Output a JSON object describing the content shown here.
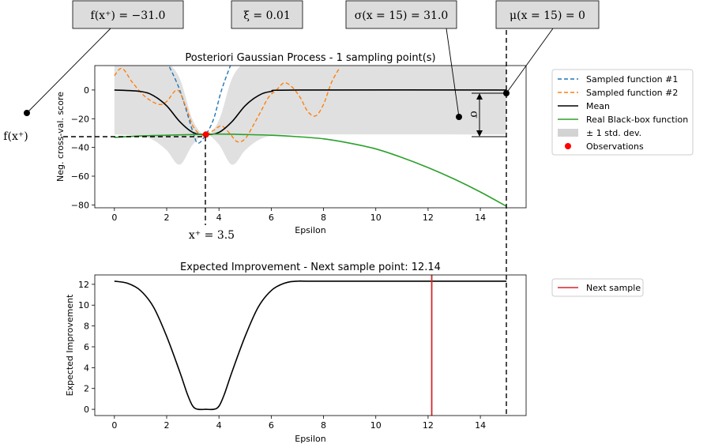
{
  "chart_data": [
    {
      "type": "line",
      "title": "Posteriori Gaussian Process - 1 sampling point(s)",
      "xlabel": "Epsilon",
      "ylabel": "Neg. cross-val. score",
      "xlim": [
        -0.75,
        15.75
      ],
      "ylim": [
        -82,
        17
      ],
      "xticks": [
        "0",
        "2",
        "4",
        "6",
        "8",
        "10",
        "12",
        "14"
      ],
      "yticks": [
        "0",
        "−20",
        "−40",
        "−60",
        "−80"
      ],
      "xtick_values": [
        0,
        2,
        4,
        6,
        8,
        10,
        12,
        14
      ],
      "ytick_values": [
        0,
        -20,
        -40,
        -60,
        -80
      ],
      "series": [
        {
          "name": "Sampled function #1",
          "color": "#1f77b4",
          "style": "dashed",
          "x": [
            2.0,
            2.5,
            3.0,
            3.2,
            3.5,
            3.8,
            4.1,
            4.5
          ],
          "y": [
            20,
            0,
            -29,
            -37,
            -31,
            -20,
            0,
            20
          ]
        },
        {
          "name": "Sampled function #2",
          "color": "#ff7f0e",
          "style": "dashed",
          "x": [
            0.0,
            0.3,
            0.7,
            1.2,
            1.7,
            2.0,
            2.4,
            2.7,
            3.0,
            3.3,
            3.5,
            3.8,
            4.1,
            4.4,
            4.7,
            5.0,
            5.3,
            5.6,
            5.9,
            6.2,
            6.5,
            6.8,
            7.1,
            7.4,
            7.7,
            8.0,
            8.3,
            8.6
          ],
          "y": [
            10,
            15,
            5,
            -5,
            -10,
            -8,
            0,
            -10,
            -25,
            -31,
            -31,
            -28,
            -25,
            -30,
            -36,
            -34,
            -25,
            -15,
            -5,
            0,
            5,
            2,
            -5,
            -15,
            -18,
            -10,
            5,
            15
          ]
        },
        {
          "name": "Mean",
          "color": "#000000",
          "style": "solid",
          "x": [
            0.0,
            1.0,
            1.5,
            2.0,
            2.5,
            3.0,
            3.5,
            4.0,
            4.5,
            5.0,
            5.5,
            6.0,
            7.0,
            15.0
          ],
          "y": [
            0,
            -1,
            -4,
            -11,
            -22,
            -29.5,
            -31,
            -29.5,
            -22,
            -11,
            -4,
            -1,
            0,
            0
          ]
        },
        {
          "name": "Real Black-box function",
          "color": "#2ca02c",
          "style": "solid",
          "x": [
            0.0,
            1.0,
            2.0,
            3.0,
            4.0,
            5.0,
            6.0,
            7.0,
            8.0,
            9.0,
            10.0,
            11.0,
            12.0,
            13.0,
            14.0,
            15.0
          ],
          "y": [
            -33,
            -32,
            -31.5,
            -31,
            -30.7,
            -31,
            -31.5,
            -32.5,
            -34,
            -37,
            -41,
            -47,
            -54,
            -62,
            -71,
            -81
          ]
        }
      ],
      "std_band": {
        "name": "± 1 std. dev.",
        "color": "#d3d3d3",
        "x": [
          0.0,
          1.0,
          1.5,
          2.0,
          2.5,
          3.0,
          3.5,
          4.0,
          4.5,
          5.0,
          5.5,
          6.0,
          7.0,
          15.0
        ],
        "upper": [
          31,
          30,
          27,
          20,
          8,
          -21,
          -31,
          -21,
          8,
          20,
          27,
          30,
          31,
          31
        ],
        "lower": [
          -31,
          -32,
          -35,
          -42,
          -52,
          -38,
          -31,
          -38,
          -52,
          -42,
          -35,
          -32,
          -31,
          -31
        ]
      },
      "observations": {
        "name": "Observations",
        "color": "#ff0000",
        "points": [
          {
            "x": 3.5,
            "y": -31
          }
        ]
      },
      "legend_position": "right",
      "grid": false
    },
    {
      "type": "line",
      "title": "Expected Improvement - Next sample point: 12.14",
      "xlabel": "Epsilon",
      "ylabel": "Expected Improvement",
      "xlim": [
        -0.75,
        15.75
      ],
      "ylim": [
        -0.6,
        12.9
      ],
      "xticks": [
        "0",
        "2",
        "4",
        "6",
        "8",
        "10",
        "12",
        "14"
      ],
      "yticks": [
        "0",
        "2",
        "4",
        "6",
        "8",
        "10",
        "12"
      ],
      "xtick_values": [
        0,
        2,
        4,
        6,
        8,
        10,
        12,
        14
      ],
      "ytick_values": [
        0,
        2,
        4,
        6,
        8,
        10,
        12
      ],
      "series": [
        {
          "name": "Expected Improvement",
          "color": "#000000",
          "style": "solid",
          "x": [
            0.0,
            0.5,
            1.0,
            1.5,
            2.0,
            2.5,
            2.8,
            3.0,
            3.2,
            3.5,
            3.8,
            4.0,
            4.2,
            4.5,
            5.0,
            5.5,
            6.0,
            6.5,
            7.0,
            8.0,
            15.0
          ],
          "y": [
            12.3,
            12.1,
            11.4,
            9.8,
            7.0,
            3.6,
            1.4,
            0.3,
            0.0,
            0.0,
            0.0,
            0.3,
            1.4,
            3.6,
            7.0,
            9.8,
            11.4,
            12.1,
            12.3,
            12.3,
            12.3
          ]
        }
      ],
      "next_sample": {
        "name": "Next sample",
        "x": 12.14,
        "color": "#d62728"
      },
      "legend_position": "right",
      "grid": false
    }
  ],
  "annotations": {
    "box_f": "f(x⁺) = −31.0",
    "box_xi": "ξ = 0.01",
    "box_sigma": "σ(x = 15) = 31.0",
    "box_mu": "μ(x = 15) = 0",
    "left_label": "f(x⁺)",
    "xplus_label": "x⁺ = 3.5",
    "sigma_symbol": "σ"
  },
  "legend1": {
    "items": [
      {
        "label": "Sampled function #1",
        "kind": "dashed",
        "color": "#1f77b4"
      },
      {
        "label": "Sampled function #2",
        "kind": "dashed",
        "color": "#ff7f0e"
      },
      {
        "label": "Mean",
        "kind": "solid",
        "color": "#000000"
      },
      {
        "label": "Real Black-box function",
        "kind": "solid",
        "color": "#2ca02c"
      },
      {
        "label": "± 1 std. dev.",
        "kind": "patch",
        "color": "#d3d3d3"
      },
      {
        "label": "Observations",
        "kind": "dot",
        "color": "#ff0000"
      }
    ]
  },
  "legend2": {
    "items": [
      {
        "label": "Next sample",
        "kind": "solid",
        "color": "#d62728"
      }
    ]
  }
}
